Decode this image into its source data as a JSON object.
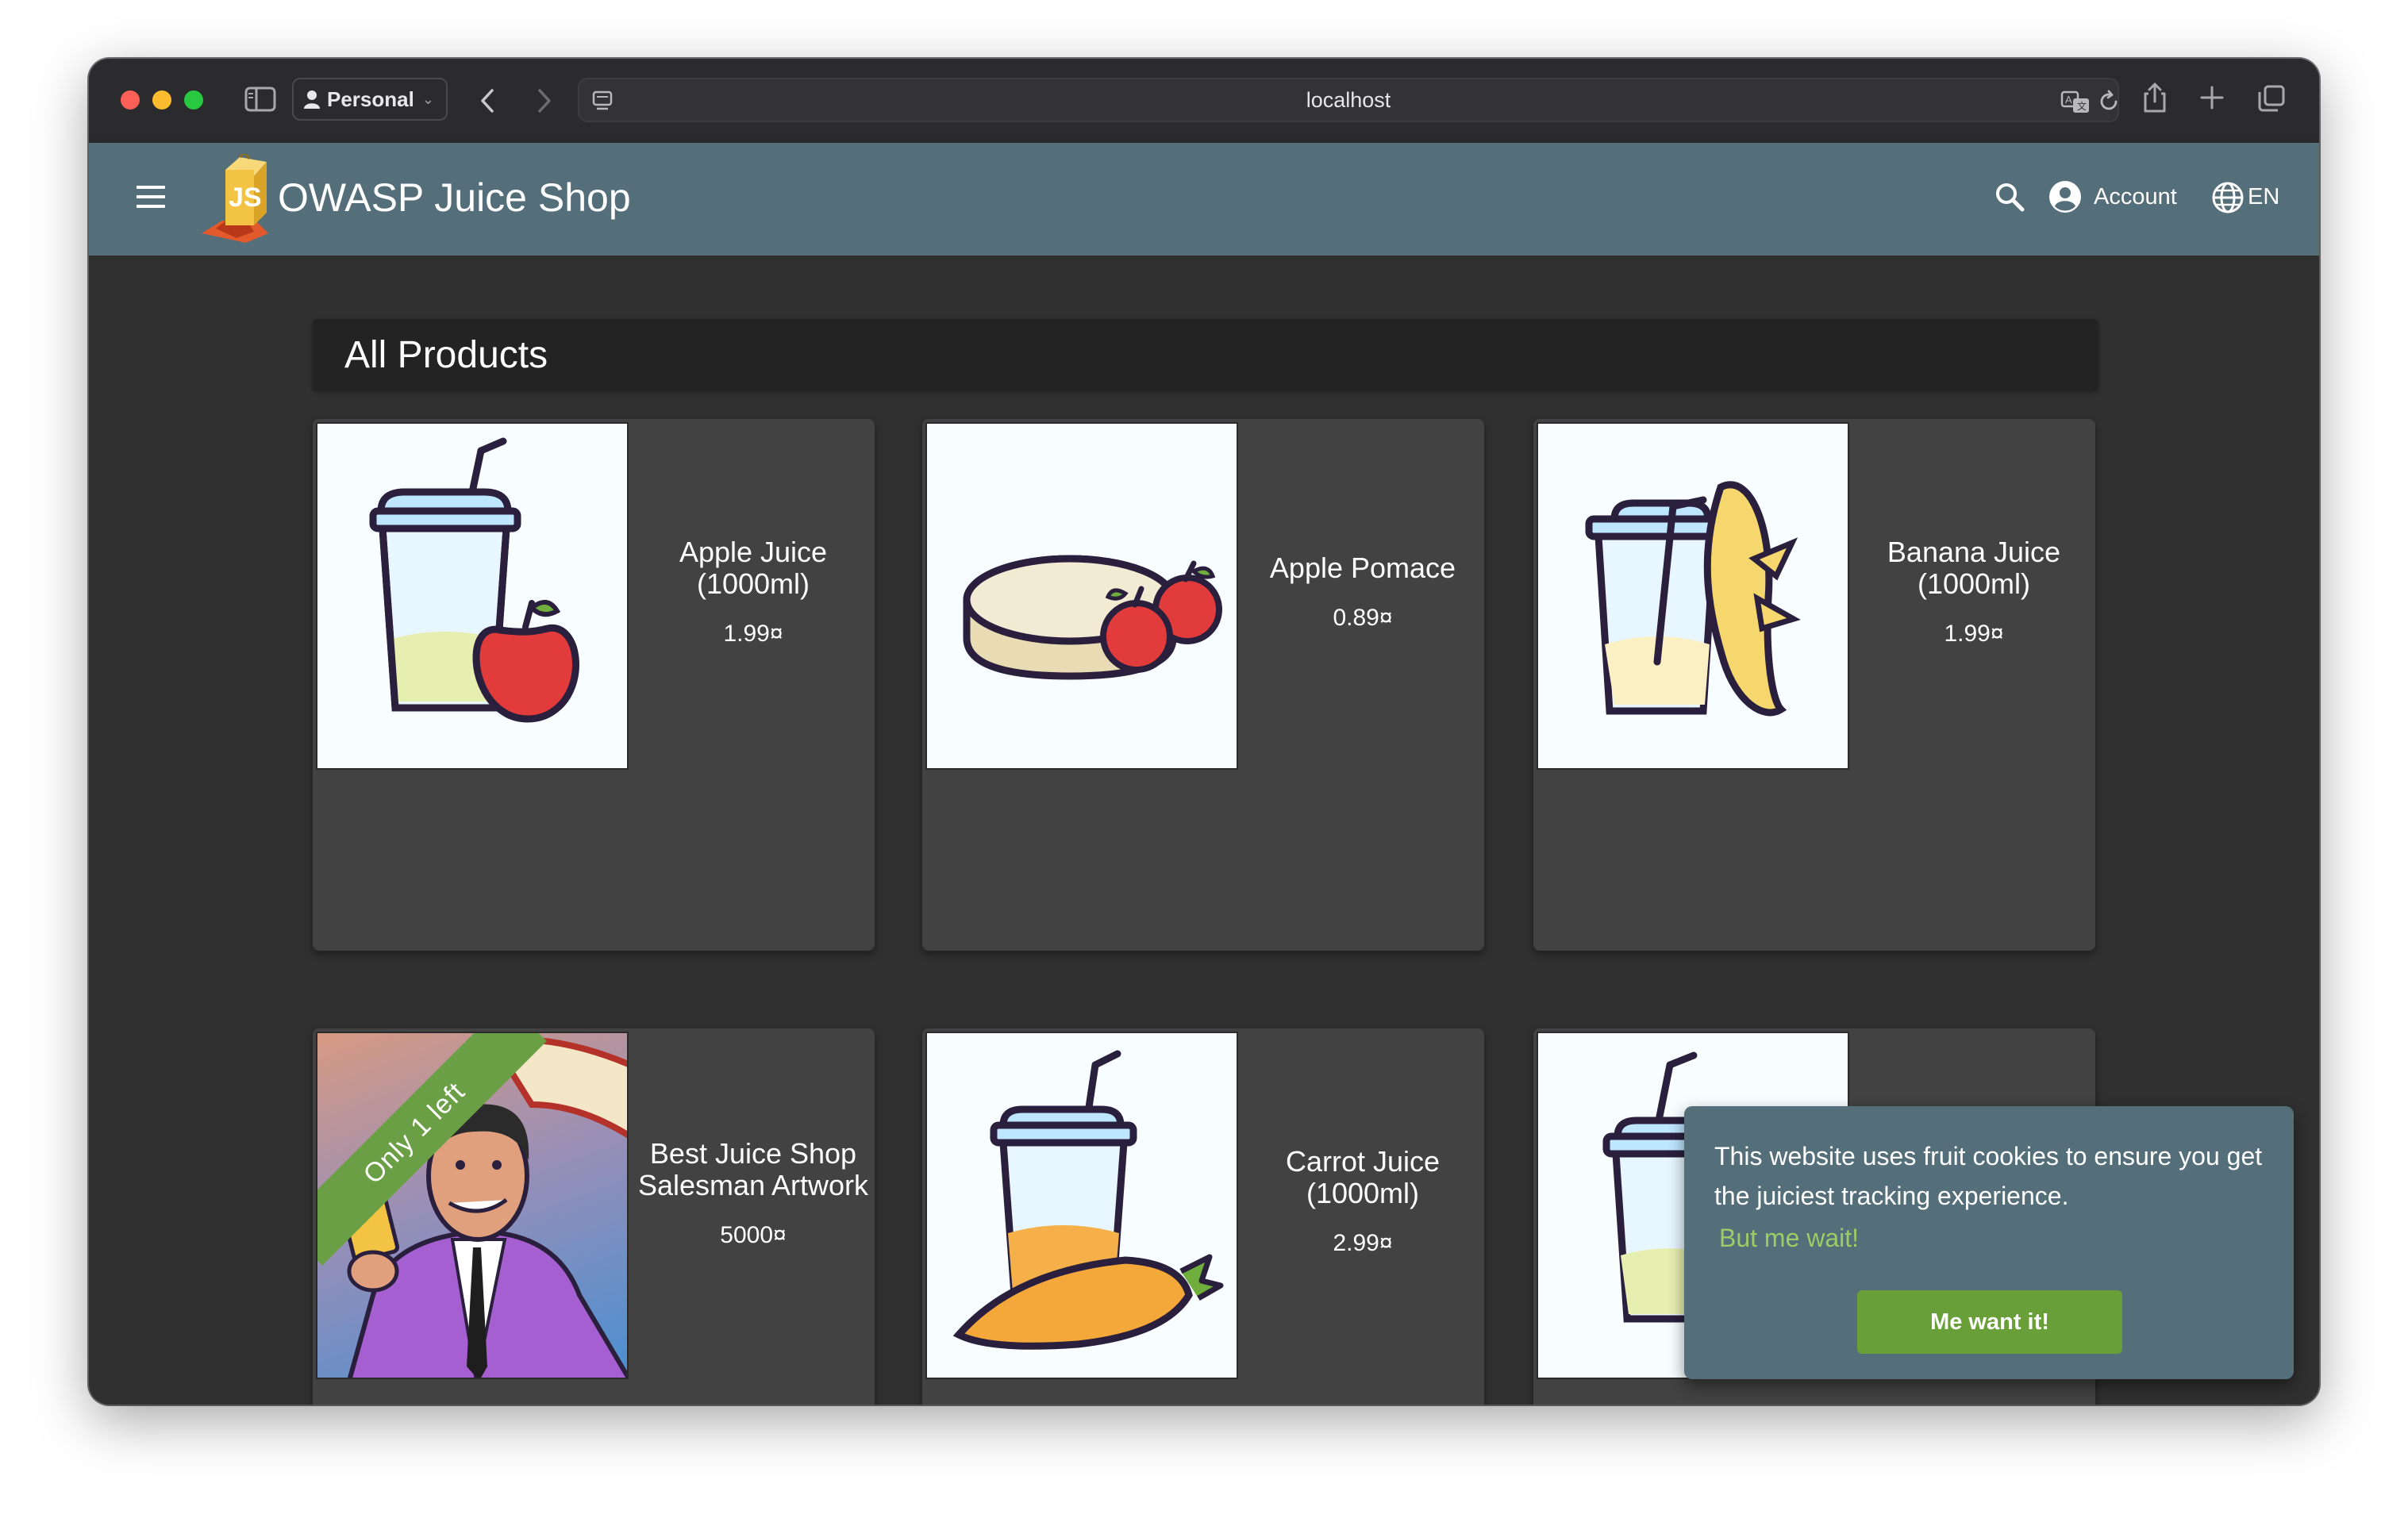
{
  "browser": {
    "profile_label": "Personal",
    "url": "localhost",
    "icons": [
      "sidebar-toggle-icon",
      "person-icon",
      "back-arrow-icon",
      "forward-arrow-icon",
      "page-menu-icon",
      "translate-icon",
      "reload-icon",
      "share-icon",
      "new-tab-icon",
      "tabs-overview-icon"
    ]
  },
  "toolbar": {
    "brand": "OWASP Juice Shop",
    "account_label": "Account",
    "language_label": "EN",
    "icons": [
      "menu-icon",
      "search-icon",
      "account-circle-icon",
      "globe-icon"
    ],
    "color": "#546e7a"
  },
  "main": {
    "heading": "All Products",
    "products": [
      {
        "name": "Apple Juice (1000ml)",
        "price": "1.99¤"
      },
      {
        "name": "Apple Pomace",
        "price": "0.89¤"
      },
      {
        "name": "Banana Juice (1000ml)",
        "price": "1.99¤"
      },
      {
        "name": "Best Juice Shop Salesman Artwork",
        "price": "5000¤",
        "badge": "Only 1 left"
      },
      {
        "name": "Carrot Juice (1000ml)",
        "price": "2.99¤"
      },
      {
        "name": "",
        "price": ""
      }
    ]
  },
  "cookie_banner": {
    "message": "This website uses fruit cookies to ensure you get the juiciest tracking experience.",
    "link_label": "But me wait!",
    "button_label": "Me want it!",
    "link_color": "#9ccc65",
    "button_color": "#689f38"
  }
}
